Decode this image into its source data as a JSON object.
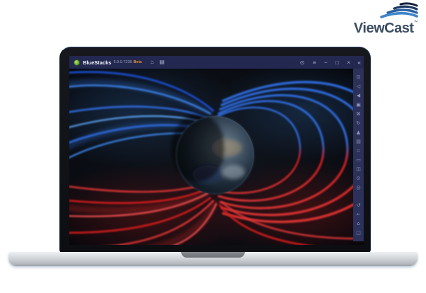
{
  "brand": {
    "name": "ViewCast",
    "trademark": "™",
    "text_color": "#3c4e63",
    "swoosh_colors": [
      "#14233c",
      "#1b3a63",
      "#2c62a2",
      "#3f86c8"
    ]
  },
  "emulator": {
    "titlebar": {
      "app_name": "BlueStacks",
      "version": "5.0.0.7228",
      "beta": "Beta",
      "left_icons": [
        {
          "name": "home-icon",
          "glyph": "⌂"
        },
        {
          "name": "media-manager-icon",
          "glyph": "▤"
        }
      ],
      "right_icons": [
        {
          "name": "boost-icon",
          "glyph": "⊙"
        },
        {
          "name": "menu-icon",
          "glyph": "≡"
        },
        {
          "name": "minimize-icon",
          "glyph": "−"
        },
        {
          "name": "maximize-icon",
          "glyph": "□"
        },
        {
          "name": "close-icon",
          "glyph": "×"
        }
      ],
      "collapse_icon": {
        "name": "collapse-sidebar-icon",
        "glyph": "«"
      }
    },
    "sidebar": {
      "tools": [
        {
          "name": "fullscreen-icon",
          "glyph": "⊡"
        },
        {
          "name": "volume-up-icon",
          "glyph": "◁"
        },
        {
          "name": "volume-down-icon",
          "glyph": "◀"
        },
        {
          "name": "screenshot-icon",
          "glyph": "▣"
        },
        {
          "name": "camera-icon",
          "glyph": "⊠"
        },
        {
          "name": "sync-icon",
          "glyph": "↻"
        },
        {
          "name": "install-apk-icon",
          "glyph": "▲"
        },
        {
          "name": "macro-recorder-icon",
          "glyph": "▤"
        },
        {
          "name": "shake-icon",
          "glyph": "▫"
        },
        {
          "name": "folder-icon",
          "glyph": "▭"
        },
        {
          "name": "multi-instance-icon",
          "glyph": "◫"
        },
        {
          "name": "settings-icon",
          "glyph": "⊙"
        },
        {
          "name": "record-icon",
          "glyph": "◎"
        }
      ],
      "nav": [
        {
          "name": "rotate-icon",
          "glyph": "↺"
        },
        {
          "name": "back-icon",
          "glyph": "←"
        },
        {
          "name": "android-home-icon",
          "glyph": "⌂"
        },
        {
          "name": "recent-apps-icon",
          "glyph": "□"
        }
      ]
    }
  },
  "colors": {
    "titlebar_bg": "#232850",
    "sidebar_bg": "#2b3158",
    "field_blue": "#2d6ce0",
    "field_red": "#d81e1e",
    "beta_orange": "#e2902f",
    "bluestacks_green": "#6cb13c"
  }
}
